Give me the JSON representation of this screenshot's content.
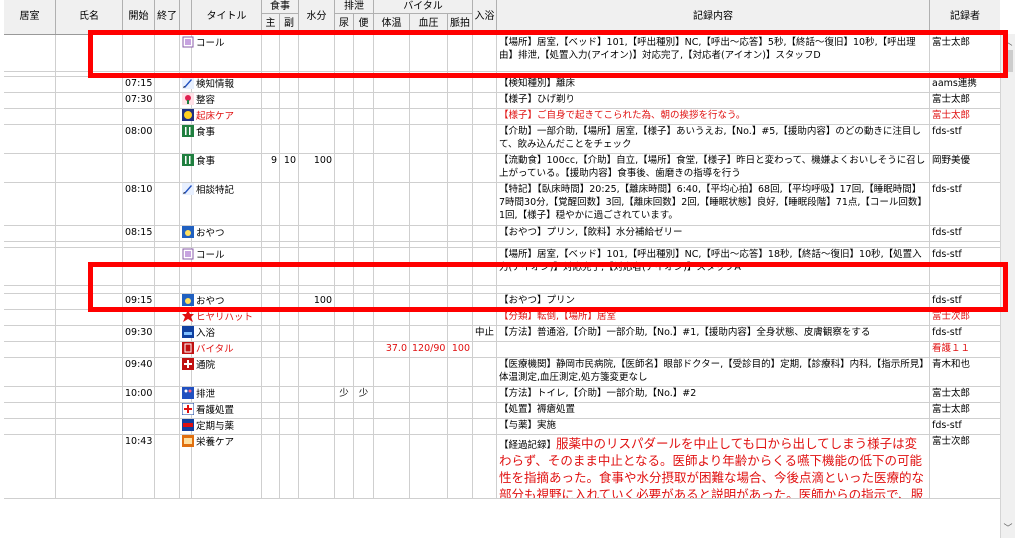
{
  "header": {
    "room": "居室",
    "name": "氏名",
    "start": "開始",
    "end": "終了",
    "title": "タイトル",
    "meal": "食事",
    "meal_main": "主",
    "meal_side": "副",
    "water": "水分",
    "excretion": "排泄",
    "urine": "尿",
    "stool": "便",
    "vital": "バイタル",
    "temp": "体温",
    "bp": "血圧",
    "pulse": "脈拍",
    "bath": "入浴",
    "content": "記録内容",
    "recorder": "記録者"
  },
  "rows": [
    {
      "h": 36,
      "start": "",
      "icon": "call-icon",
      "title": "コール",
      "content": "【場所】居室,【ベッド】101,【呼出種別】NC,【呼出～応答】5秒,【終話～復旧】10秒,【呼出理由】排泄,【処置入力(アイオン)】対応完了,【対応者(アイオン)】スタッフD",
      "recorder": "富士太郎"
    },
    {
      "h": 5,
      "start": "",
      "icon": "",
      "title": "",
      "content": "",
      "recorder": ""
    },
    {
      "h": 16,
      "start": "07:15",
      "icon": "pen-icon",
      "title": "検知情報",
      "content": "【検知種別】離床",
      "recorder": "aams連携"
    },
    {
      "h": 16,
      "start": "07:30",
      "icon": "grooming-icon",
      "title": "整容",
      "content": "【様子】ひげ剃り",
      "recorder": "富士太郎"
    },
    {
      "h": 16,
      "start": "",
      "icon": "wakeup-icon",
      "title": "起床ケア",
      "red": true,
      "content": "【様子】ご自身で起きてこられた為、朝の挨拶を行なう。",
      "recorder": "富士太郎"
    },
    {
      "h": 29,
      "start": "08:00",
      "icon": "meal-icon",
      "title": "食事",
      "content": "【介助】一部介助,【場所】居室,【様子】あいうえお,【No.】#5,【援助内容】のどの動きに注目して、飲み込んだことをチェック",
      "recorder": "fds-stf"
    },
    {
      "h": 29,
      "start": "",
      "icon": "meal-icon",
      "title": "食事",
      "meal_main": "9",
      "meal_side": "10",
      "water": "100",
      "content": "【流動食】100cc,【介助】自立,【場所】食堂,【様子】昨日と変わって、機嫌よくおいしそうに召し上がっている。【援助内容】食事後、歯磨きの指導を行う",
      "recorder": "岡野美優"
    },
    {
      "h": 43,
      "start": "08:10",
      "icon": "pen-icon",
      "title": "相談特記",
      "content": "【特記】【臥床時間】20:25,【離床時間】6:40,【平均心拍】68回,【平均呼吸】17回,【睡眠時間】7時間30分,【覚醒回数】3回,【離床回数】2回,【睡眠状態】良好,【睡眠段階】71点,【コール回数】1回,【様子】穏やかに過ごされています。",
      "recorder": "fds-stf"
    },
    {
      "h": 16,
      "start": "08:15",
      "icon": "snack-icon",
      "title": "おやつ",
      "content": "【おやつ】プリン,【飲料】水分補給ゼリー",
      "recorder": "fds-stf"
    },
    {
      "h": 6,
      "start": "",
      "icon": "",
      "title": "",
      "content": "",
      "recorder": ""
    },
    {
      "h": 38,
      "start": "",
      "icon": "call-icon",
      "title": "コール",
      "content": "【場所】居室,【ベッド】101,【呼出種別】NC,【呼出～応答】18秒,【終話～復旧】10秒,【処置入力(アイオン)】対応完了,【対応者(アイオン)】スタッフA",
      "recorder": "fds-stf"
    },
    {
      "h": 8,
      "start": "",
      "icon": "",
      "title": "",
      "content": "",
      "recorder": ""
    },
    {
      "h": 16,
      "start": "09:15",
      "icon": "snack-icon",
      "title": "おやつ",
      "water": "100",
      "content": "【おやつ】プリン",
      "recorder": "fds-stf"
    },
    {
      "h": 16,
      "start": "",
      "icon": "hiyari-icon",
      "title": "ヒヤリハット",
      "red": true,
      "content": "【分類】転倒,【場所】居室",
      "recorder": "富士次郎"
    },
    {
      "h": 16,
      "start": "09:30",
      "icon": "bath-icon",
      "title": "入浴",
      "bath": "中止",
      "content": "【方法】普通浴,【介助】一部介助,【No.】#1,【援助内容】全身状態、皮膚観察をする",
      "recorder": "fds-stf"
    },
    {
      "h": 16,
      "start": "",
      "icon": "vital-icon",
      "title": "バイタル",
      "red": true,
      "temp": "37.0",
      "bp": "120/90",
      "pulse": "100",
      "content": "",
      "recorder": "看護１１"
    },
    {
      "h": 29,
      "start": "09:40",
      "icon": "hospital-icon",
      "title": "通院",
      "content": "【医療機関】静岡市民病院,【医師名】眼部ドクター,【受診目的】定期,【診療科】内科,【指示所見】体温測定,血圧測定,処方箋変更なし",
      "recorder": "青木和也"
    },
    {
      "h": 16,
      "start": "10:00",
      "icon": "toilet-icon",
      "title": "排泄",
      "urine": "少",
      "stool": "少",
      "content": "【方法】トイレ,【介助】一部介助,【No.】#2",
      "recorder": "富士太郎"
    },
    {
      "h": 16,
      "start": "",
      "icon": "nurse-icon",
      "title": "看護処置",
      "content": "【処置】褥瘡処置",
      "recorder": "富士太郎"
    },
    {
      "h": 16,
      "start": "",
      "icon": "medicine-icon",
      "title": "定期与薬",
      "content": "【与薬】実施",
      "recorder": "fds-stf"
    },
    {
      "h": 64,
      "start": "10:43",
      "icon": "nutrition-icon",
      "title": "栄養ケア",
      "big": true,
      "content_prefix": "【経過記録】",
      "content": "服薬中のリスパダールを中止しても口から出してしまう様子は変わらず、そのまま中止となる。医師より年齢からくる嚥下機能の低下の可能性を指摘あった。食事や水分摂取が困難な場合、今後点滴といった医療的な部分も視野に入れていく必要があると説明があった。医師からの指示で、服薬方法の工夫について試行し結果を",
      "recorder": "富士次郎"
    }
  ],
  "colors": {
    "highlight": "#ff0000",
    "red_text": "#e01010",
    "header_bg": "#f0f0f0"
  }
}
